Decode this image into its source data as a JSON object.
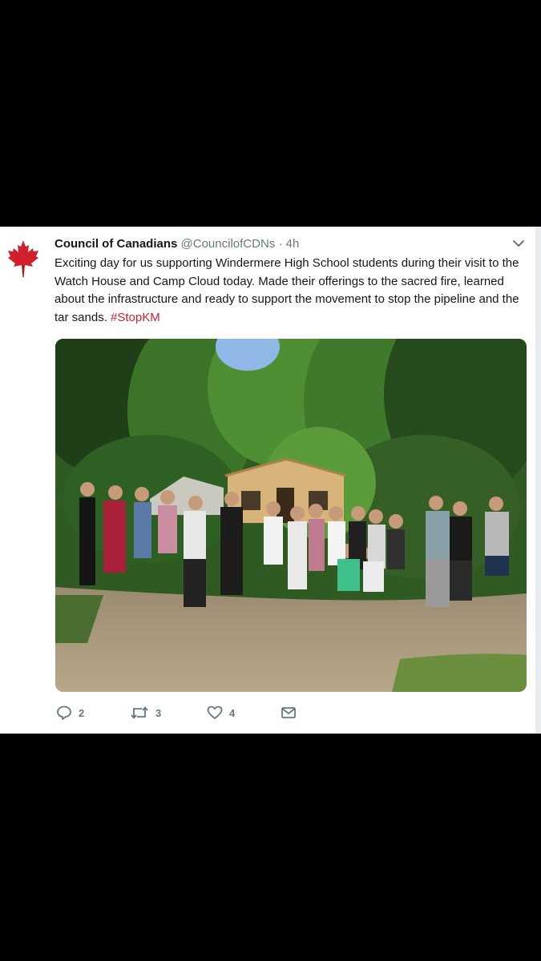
{
  "tweet": {
    "display_name": "Council of Canadians",
    "handle": "@CouncilofCDNs",
    "separator": "·",
    "time": "4h",
    "text_main": "Exciting day for us supporting Windermere High School students during their visit to the Watch House and Camp Cloud today. Made their offerings to the sacred fire, learned about the infrastructure and ready to support the movement to stop the pipeline and the tar sands.",
    "hashtag": "#StopKM",
    "photo_icon": "group-photo-students-forest",
    "actions": {
      "reply": {
        "icon": "reply-icon",
        "count": "2"
      },
      "retweet": {
        "icon": "retweet-icon",
        "count": "3"
      },
      "like": {
        "icon": "heart-icon",
        "count": "4"
      },
      "dm": {
        "icon": "envelope-icon"
      }
    }
  },
  "colors": {
    "hashtag": "#d0202b",
    "avatar_leaf": "#d0202b",
    "secondary_text": "#657786",
    "primary_text": "#14171a"
  }
}
